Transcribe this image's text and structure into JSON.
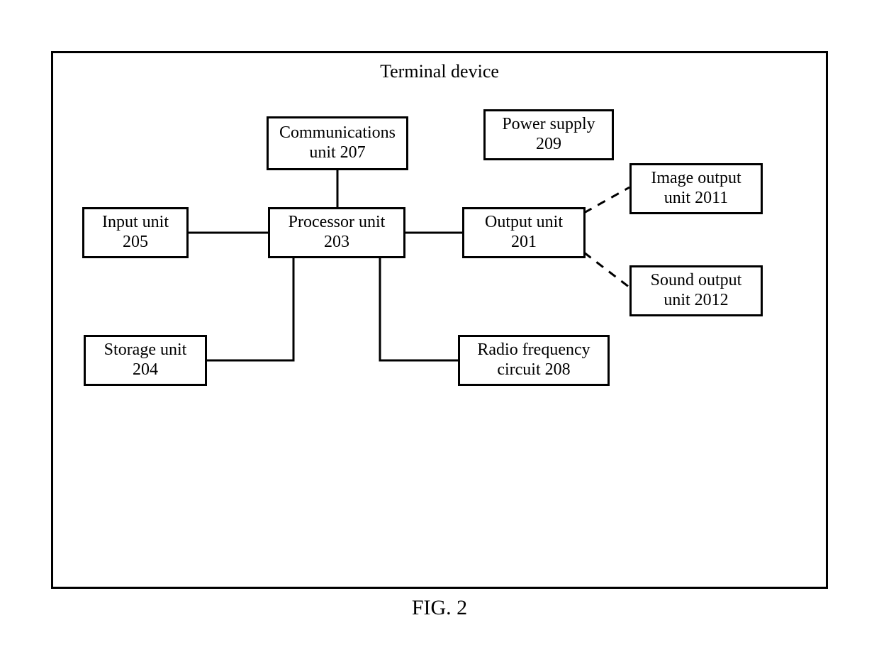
{
  "diagram": {
    "title": "Terminal device",
    "caption": "FIG. 2",
    "blocks": {
      "communications": {
        "line1": "Communications",
        "line2": "unit 207"
      },
      "power": {
        "line1": "Power supply",
        "line2": "209"
      },
      "input": {
        "line1": "Input unit",
        "line2": "205"
      },
      "processor": {
        "line1": "Processor unit",
        "line2": "203"
      },
      "output": {
        "line1": "Output unit",
        "line2": "201"
      },
      "image_out": {
        "line1": "Image output",
        "line2": "unit 2011"
      },
      "sound_out": {
        "line1": "Sound output",
        "line2": "unit 2012"
      },
      "storage": {
        "line1": "Storage unit",
        "line2": "204"
      },
      "rf": {
        "line1": "Radio frequency",
        "line2": "circuit 208"
      }
    }
  }
}
